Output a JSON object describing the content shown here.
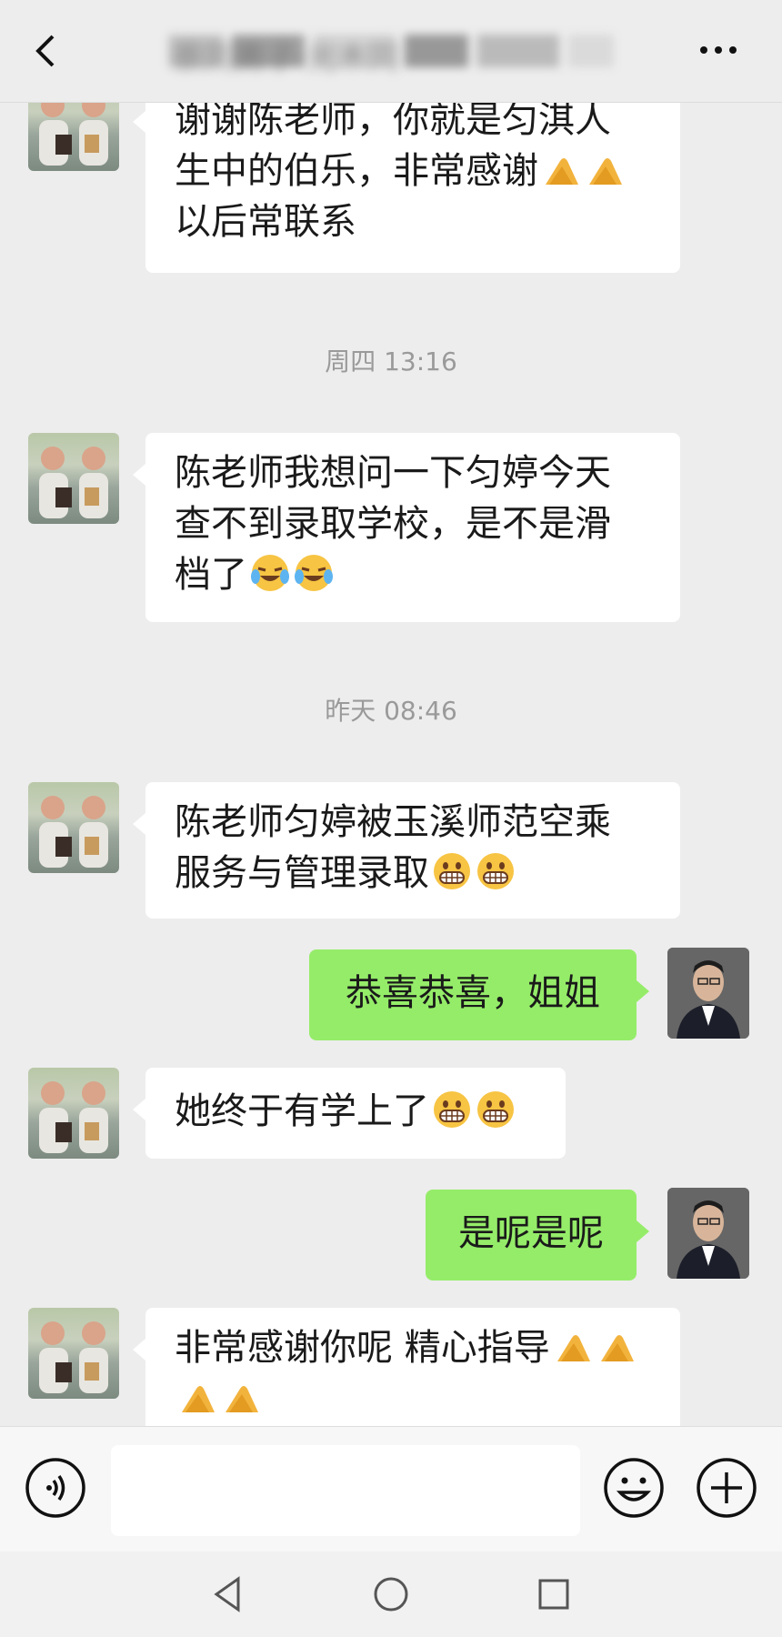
{
  "header": {
    "title": "蔡同男子·光木同"
  },
  "messages": [
    {
      "side": "left",
      "text": "谢谢陈老师，你就是匀淇人\n生中的伯乐，非常感谢",
      "emoji_after": [
        "ok-hand-icon",
        "ok-hand-icon"
      ],
      "text2": "\n以后常联系"
    },
    {
      "type": "time",
      "text": "周四 13:16"
    },
    {
      "side": "left",
      "text": "陈老师我想问一下匀婷今天\n查不到录取学校，是不是滑\n档了",
      "emoji_after": [
        "crying-laughing-icon",
        "crying-laughing-icon"
      ]
    },
    {
      "type": "time",
      "text": "昨天 08:46"
    },
    {
      "side": "left",
      "text": "陈老师匀婷被玉溪师范空乘\n服务与管理录取",
      "emoji_after": [
        "grinning-icon",
        "grinning-icon"
      ]
    },
    {
      "side": "right",
      "text": "恭喜恭喜，姐姐"
    },
    {
      "side": "left",
      "text": "她终于有学上了",
      "emoji_after": [
        "grinning-icon",
        "grinning-icon"
      ]
    },
    {
      "side": "right",
      "text": "是呢是呢"
    },
    {
      "side": "left",
      "text": "非常感谢你呢 精心指导",
      "emoji_after": [
        "ok-hand-icon",
        "ok-hand-icon"
      ],
      "emoji_line2": [
        "ok-hand-icon",
        "ok-hand-icon"
      ]
    }
  ],
  "msgs": {
    "m1_l1": "谢谢陈老师，你就是匀淇人",
    "m1_l2": "生中的伯乐，非常感谢",
    "m1_l3": "以后常联系",
    "t1": "周四 13:16",
    "m2_l1": "陈老师我想问一下匀婷今天",
    "m2_l2": "查不到录取学校，是不是滑",
    "m2_l3": "档了",
    "t2": "昨天 08:46",
    "m3_l1": "陈老师匀婷被玉溪师范空乘",
    "m3_l2": "服务与管理录取",
    "m4": "恭喜恭喜，姐姐",
    "m5": "她终于有学上了",
    "m6": "是呢是呢",
    "m7_l1": "非常感谢你呢 精心指导"
  },
  "colors": {
    "background": "#ededed",
    "bubble_left": "#ffffff",
    "bubble_right": "#95ec69",
    "timestamp": "#9a9a9a"
  },
  "input": {
    "value": "",
    "placeholder": ""
  }
}
